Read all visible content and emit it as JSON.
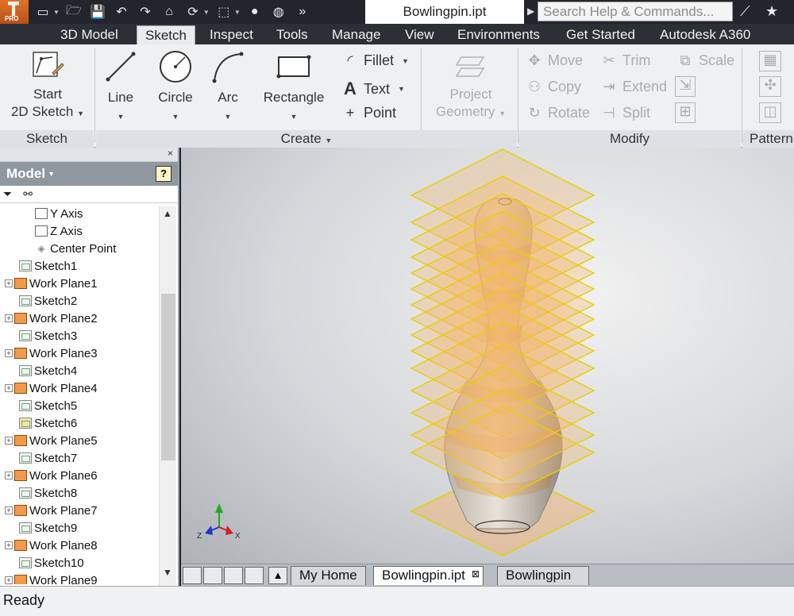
{
  "document": {
    "title": "Bowlingpin.ipt"
  },
  "search": {
    "placeholder": "Search Help & Commands..."
  },
  "app_badge": "PRO",
  "ribbon_tabs": [
    {
      "label": "3D Model"
    },
    {
      "label": "Sketch"
    },
    {
      "label": "Inspect"
    },
    {
      "label": "Tools"
    },
    {
      "label": "Manage"
    },
    {
      "label": "View"
    },
    {
      "label": "Environments"
    },
    {
      "label": "Get Started"
    },
    {
      "label": "Autodesk A360"
    }
  ],
  "ribbon": {
    "sketch_panel": {
      "footer": "Sketch",
      "start_line1": "Start",
      "start_line2": "2D Sketch"
    },
    "create_panel": {
      "footer": "Create",
      "line": "Line",
      "circle": "Circle",
      "arc": "Arc",
      "rectangle": "Rectangle",
      "fillet": "Fillet",
      "text": "Text",
      "point": "Point",
      "project_line1": "Project",
      "project_line2": "Geometry"
    },
    "modify_panel": {
      "footer": "Modify",
      "move": "Move",
      "trim": "Trim",
      "scale": "Scale",
      "copy": "Copy",
      "extend": "Extend",
      "rotate": "Rotate",
      "split": "Split"
    },
    "pattern_panel": {
      "footer": "Pattern"
    }
  },
  "browser": {
    "title": "Model",
    "help": "?",
    "items": [
      {
        "label": "Y Axis"
      },
      {
        "label": "Z Axis"
      },
      {
        "label": "Center Point"
      },
      {
        "label": "Sketch1"
      },
      {
        "label": "Work Plane1"
      },
      {
        "label": "Sketch2"
      },
      {
        "label": "Work Plane2"
      },
      {
        "label": "Sketch3"
      },
      {
        "label": "Work Plane3"
      },
      {
        "label": "Sketch4"
      },
      {
        "label": "Work Plane4"
      },
      {
        "label": "Sketch5"
      },
      {
        "label": "Sketch6"
      },
      {
        "label": "Work Plane5"
      },
      {
        "label": "Sketch7"
      },
      {
        "label": "Work Plane6"
      },
      {
        "label": "Sketch8"
      },
      {
        "label": "Work Plane7"
      },
      {
        "label": "Sketch9"
      },
      {
        "label": "Work Plane8"
      },
      {
        "label": "Sketch10"
      },
      {
        "label": "Work Plane9"
      }
    ]
  },
  "triad": {
    "x_label": "X",
    "z_label": "Z"
  },
  "doc_tabs": [
    {
      "label": "My Home"
    },
    {
      "label": "Bowlingpin.ipt"
    },
    {
      "label": "Bowlingpin"
    }
  ],
  "status": {
    "text": "Ready"
  },
  "colors": {
    "plane_outline": "#e8d000",
    "plane_fill": "#f3b46a",
    "app_orange": "#e3722a"
  }
}
